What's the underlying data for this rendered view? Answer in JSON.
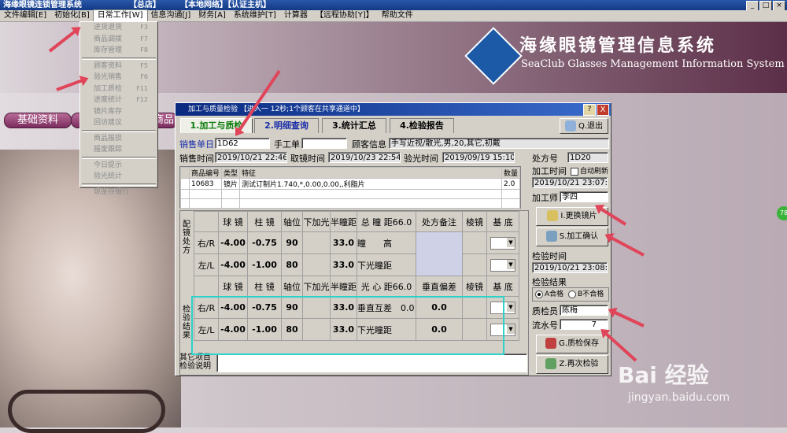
{
  "app": {
    "title": "海缘眼镜连锁管理系统",
    "branch": "【总店】",
    "network": "【本地网络】【认证主机】"
  },
  "menubar": [
    "文件编辑[E]",
    "初始化[B]",
    "日常工作[W]",
    "信息沟通[J]",
    "财务[A]",
    "系统维护[T]",
    "计算器",
    "【远程协助[Y]】",
    "帮助文件"
  ],
  "dropdown": {
    "items": [
      {
        "label": "进货退货",
        "shortcut": "F3"
      },
      {
        "label": "商品调拨",
        "shortcut": "F7"
      },
      {
        "label": "库存管理",
        "shortcut": "F8"
      },
      {
        "sep": true
      },
      {
        "label": "顾客资料",
        "shortcut": "F5"
      },
      {
        "label": "验光销售",
        "shortcut": "F6"
      },
      {
        "label": "加工质检",
        "shortcut": "F11"
      },
      {
        "label": "进度统计",
        "shortcut": "F12"
      },
      {
        "label": "镜片库存",
        "shortcut": ""
      },
      {
        "label": "回访建议",
        "shortcut": ""
      },
      {
        "sep": true
      },
      {
        "label": "商品报损",
        "shortcut": ""
      },
      {
        "label": "报废跟踪",
        "shortcut": ""
      },
      {
        "sep": true
      },
      {
        "label": "今日提示",
        "shortcut": ""
      },
      {
        "label": "验光统计",
        "shortcut": ""
      },
      {
        "sep": true
      },
      {
        "label": "现金存银行",
        "shortcut": ""
      }
    ]
  },
  "banner": {
    "cn": "海缘眼镜管理信息系统",
    "en": "SeaClub Glasses Management Information System"
  },
  "nav": {
    "basic": "基础资料",
    "goods": "商品"
  },
  "badge": "78",
  "dialog": {
    "title": "加工与质量检验 【进入一 12秒;1个顾客在共享通道中】",
    "help": "?",
    "close": "X",
    "tabs": [
      "1.加工与质检",
      "2.明细查询",
      "3.统计汇总",
      "4.检验报告"
    ],
    "exit_label": "Q.退出",
    "sale_no_label": "销售单日",
    "sale_no": "1D62",
    "manual_label": "手工单",
    "manual_value": "",
    "customer_label": "顾客信息",
    "customer_value": "手写近视/散光,男,20,其它,初戴",
    "rx_no_label": "处方号",
    "rx_no": "1D20",
    "sale_time_label": "销售时间",
    "sale_time": "2019/10/21 22:46",
    "pick_time_label": "取镜时间",
    "pick_time": "2019/10/23 22:54",
    "check_time_label": "验光时间",
    "check_time": "2019/09/19 15:10",
    "goods_header": [
      "商品编号",
      "类型",
      "特征",
      "数量"
    ],
    "goods_rows": [
      [
        "10683",
        "镜片",
        "测试订制片1.740,*,0.00,0.00,,利脂片",
        "2.0"
      ]
    ],
    "process_time_label": "加工时间",
    "auto_refresh": "自动刷新",
    "process_time": "2019/10/21 23:07:",
    "worker_label": "加工师",
    "worker": "李四",
    "replace_btn": "I.更换镜片",
    "confirm_btn": "S.加工确认",
    "inspect_time_label": "检验时间",
    "inspect_time": "2019/10/21 23:08:",
    "result_label": "检验结果",
    "pass": "A合格",
    "fail": "B不合格",
    "inspector_label": "质检员",
    "inspector": "陈梅",
    "serial_label": "流水号",
    "serial": "7",
    "save_btn": "G.质检保存",
    "recheck_btn": "Z.再次检验",
    "other_label": "其它项目",
    "other_label2": "检验说明",
    "rx_side_top": "配镜处方",
    "rx_side_bottom": "检验结果",
    "rx_header": [
      "球 镜",
      "柱 镜",
      "轴位",
      "下加光",
      "半瞳距",
      "总 瞳 距66.0",
      "处方备注",
      "棱镜",
      "基 底"
    ],
    "rx_rows": [
      {
        "eye": "右/R",
        "sph": "-4.00",
        "cyl": "-0.75",
        "axis": "90",
        "add": "",
        "pd": "33.0",
        "extra": "瞳　　高"
      },
      {
        "eye": "左/L",
        "sph": "-4.00",
        "cyl": "-1.00",
        "axis": "80",
        "add": "",
        "pd": "33.0",
        "extra": "下光瞳距"
      }
    ],
    "chk_header": [
      "球 镜",
      "柱 镜",
      "轴位",
      "下加光",
      "半瞳距",
      "光 心 距66.0",
      "垂直偏差",
      "棱镜",
      "基 底"
    ],
    "chk_rows": [
      {
        "eye": "右/R",
        "sph": "-4.00",
        "cyl": "-0.75",
        "axis": "90",
        "add": "",
        "pd": "33.0",
        "extra": "垂直互差　0.0",
        "dev": "0.0"
      },
      {
        "eye": "左/L",
        "sph": "-4.00",
        "cyl": "-1.00",
        "axis": "80",
        "add": "",
        "pd": "33.0",
        "extra": "下光瞳距",
        "dev": "0.0"
      }
    ]
  },
  "watermark": {
    "brand": "Bai 经验",
    "url": "jingyan.baidu.com"
  }
}
